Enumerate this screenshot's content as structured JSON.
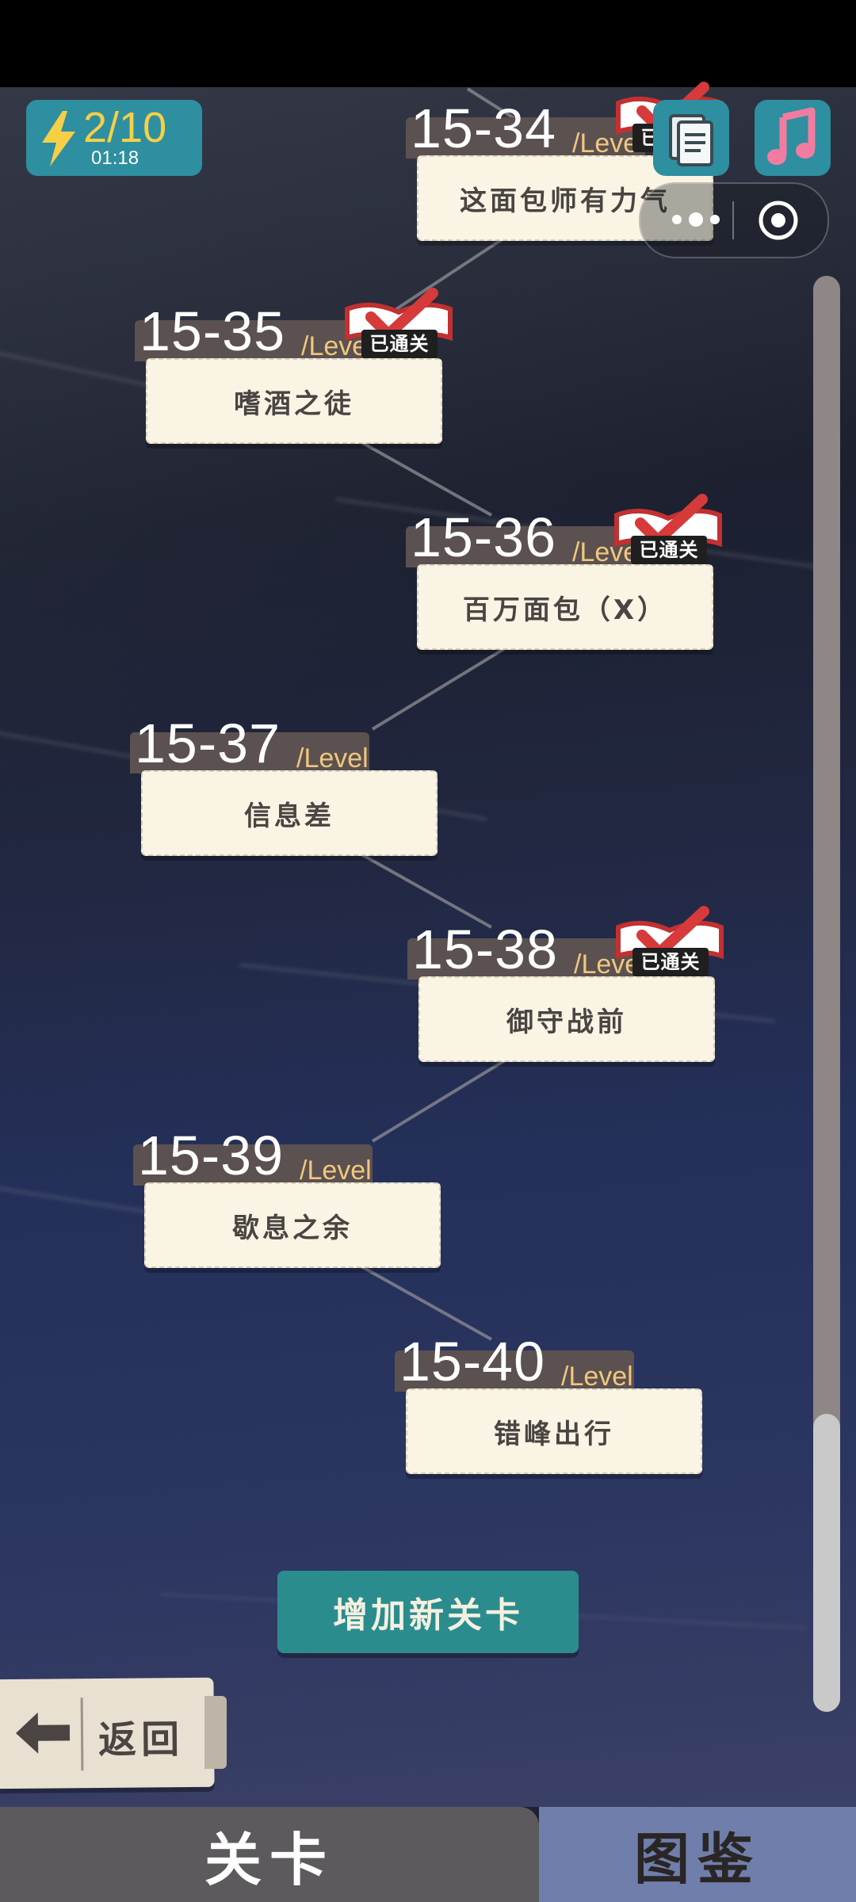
{
  "hud": {
    "energy_value": "2/10",
    "energy_timer": "01:18",
    "icons": [
      "lightning-icon",
      "notes-icon",
      "music-note-icon",
      "more-dots-icon",
      "target-icon"
    ]
  },
  "levels": [
    {
      "number": "15-34",
      "suffix": "/Level",
      "title": "这面包师有力气",
      "cleared": true
    },
    {
      "number": "15-35",
      "suffix": "/Level",
      "title": "嗜酒之徒",
      "cleared": true
    },
    {
      "number": "15-36",
      "suffix": "/Level",
      "title": "百万面包（X）",
      "cleared": true
    },
    {
      "number": "15-37",
      "suffix": "/Level",
      "title": "信息差",
      "cleared": false
    },
    {
      "number": "15-38",
      "suffix": "/Level",
      "title": "御守战前",
      "cleared": true
    },
    {
      "number": "15-39",
      "suffix": "/Level",
      "title": "歇息之余",
      "cleared": false
    },
    {
      "number": "15-40",
      "suffix": "/Level",
      "title": "错峰出行",
      "cleared": false
    }
  ],
  "cleared_badge_label": "已通关",
  "add_level_button": "增加新关卡",
  "back_button": "返回",
  "tabs": {
    "levels": "关卡",
    "gallery": "图鉴",
    "active": "levels"
  },
  "colors": {
    "teal": "#2e8fa0",
    "card": "#f9f4e3",
    "badge_red": "#d63a3a",
    "tab_active": "#5c5a5c",
    "tab_inactive": "#6f7eaa"
  },
  "scroll_position": 0.95
}
